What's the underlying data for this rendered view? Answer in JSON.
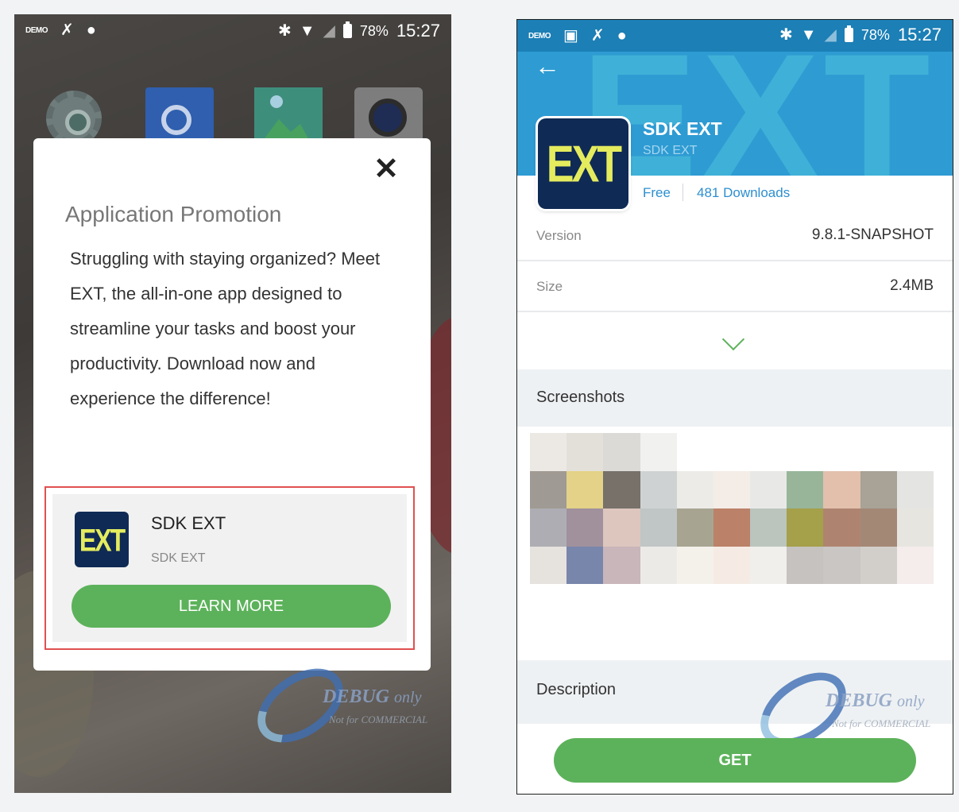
{
  "statusbar": {
    "demo": "DEMO",
    "battery": "78%",
    "time": "15:27"
  },
  "left": {
    "dialog": {
      "title": "Application Promotion",
      "body": "Struggling with staying organized? Meet EXT, the all-in-one app designed to streamline your tasks and boost your productivity. Download now and experience the difference!",
      "close_icon": "close-icon"
    },
    "promo": {
      "logo_text": "EXT",
      "name": "SDK EXT",
      "subtitle": "SDK EXT",
      "button": "LEARN MORE"
    }
  },
  "right": {
    "header_bg_text": "EXT",
    "app": {
      "logo_text": "EXT",
      "name": "SDK EXT",
      "subtitle": "SDK EXT",
      "price": "Free",
      "downloads": "481 Downloads"
    },
    "info": [
      {
        "key": "Version",
        "value": "9.8.1-SNAPSHOT"
      },
      {
        "key": "Size",
        "value": "2.4MB"
      }
    ],
    "sections": {
      "screenshots": "Screenshots",
      "description": "Description"
    },
    "get_button": "GET"
  },
  "watermark": {
    "text": "DEBUG",
    "only": "only",
    "sub": "Not for COMMERCIAL"
  },
  "colors": {
    "accent_green": "#5cb25a",
    "header_blue": "#2e9bd3",
    "link_blue": "#2d8fd0",
    "logo_navy": "#0f2a55",
    "logo_yellow": "#e4ec5e",
    "highlight_red": "#e05050"
  },
  "icons": [
    "demo-icon",
    "no-notification-icon",
    "message-icon",
    "bluetooth-icon",
    "wifi-icon",
    "no-sim-icon",
    "battery-icon",
    "image-icon",
    "back-arrow-icon",
    "chevron-down-icon",
    "close-icon",
    "settings-app-icon",
    "chrome-app-icon",
    "gallery-app-icon",
    "camera-app-icon"
  ]
}
